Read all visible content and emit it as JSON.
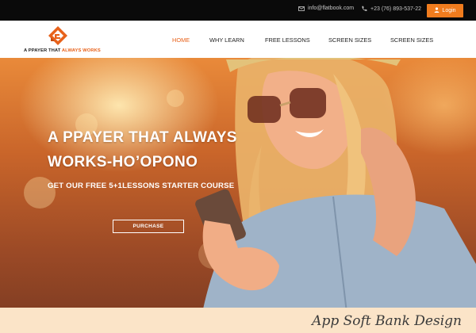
{
  "topbar": {
    "email": "info@flatbook.com",
    "phone": "+23 (76) 893-537-22",
    "login_label": "Login",
    "icons": [
      "mail-icon",
      "phone-icon",
      "user-icon"
    ]
  },
  "logo": {
    "text_before": "A PPAYER THAT ",
    "text_highlight": "ALWAYS WORKS"
  },
  "nav": {
    "items": [
      "HOME",
      "WHY LEARN",
      "FREE LESSONS",
      "SCREEN SIZES",
      "SCREEN SIZES"
    ],
    "active": "HOME"
  },
  "hero": {
    "title_line1": "A PPAYER THAT ALWAYS",
    "title_line2": "WORKS-HO’OPONO",
    "subtitle": "GET OUR FREE 5+1LESSONS STARTER COURSE",
    "cta_label": "PURCHASE"
  },
  "watermark": "App Soft Bank Design",
  "colors": {
    "accent": "#e8621b",
    "login_bg": "#f07c1e",
    "topbar_bg": "#0a0a0a",
    "footer_band": "#fbe4c8"
  }
}
